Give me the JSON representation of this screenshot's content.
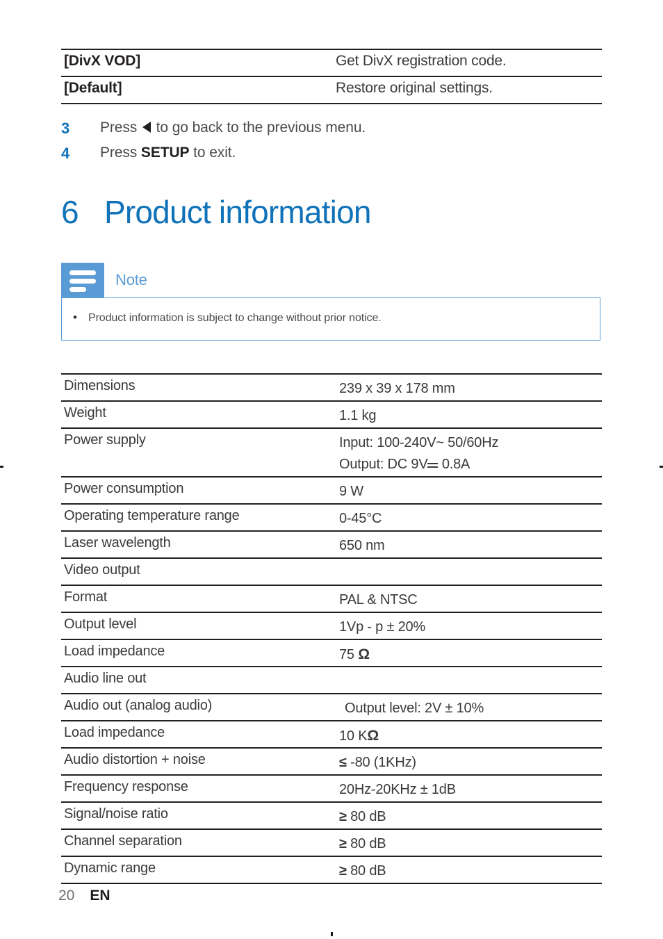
{
  "page": {
    "number": "20",
    "language": "EN"
  },
  "settings_table": {
    "rows": [
      {
        "label": "[DivX VOD]",
        "value": "Get DivX registration code."
      },
      {
        "label": "[Default]",
        "value": "Restore original settings."
      }
    ]
  },
  "steps": [
    {
      "num": "3",
      "text_before": "Press ",
      "icon": "left-arrow-icon",
      "text_after": " to go back to the previous menu."
    },
    {
      "num": "4",
      "text_before": "Press ",
      "bold": "SETUP",
      "text_after": " to exit."
    }
  ],
  "chapter": {
    "number": "6",
    "title": "Product information",
    "color": "#1072b8"
  },
  "note": {
    "icon": "note-lines-icon",
    "title": "Note",
    "accent_color": "#5b9bd5",
    "items": [
      "Product information is subject to change without prior notice."
    ]
  },
  "spec_table": {
    "rows": [
      {
        "label": "Dimensions",
        "value": "239 x 39 x 178 mm"
      },
      {
        "label": "Weight",
        "value": "1.1 kg"
      },
      {
        "label": "Power supply",
        "value_line1": "Input: 100-240V~ 50/60Hz",
        "value_line2_prefix": "Output: DC 9V",
        "value_line2_suffix": " 0.8A"
      },
      {
        "label": "Power consumption",
        "value": "9 W"
      },
      {
        "label": "Operating temperature range",
        "value": "0-45°C"
      },
      {
        "label": "Laser wavelength",
        "value": "650 nm"
      },
      {
        "label": "Video output",
        "value": ""
      },
      {
        "label": "Format",
        "value": "PAL & NTSC"
      },
      {
        "label": "Output level",
        "value": "1Vp - p ± 20%"
      },
      {
        "label": "Load impedance",
        "value_num": "75 ",
        "value_sym": "Ω"
      },
      {
        "label": "Audio line out",
        "value": ""
      },
      {
        "label": "Audio out (analog audio)",
        "value": "Output level: 2V ± 10%"
      },
      {
        "label": "Load impedance",
        "value_num": "10 K",
        "value_sym": "Ω"
      },
      {
        "label": "Audio distortion + noise",
        "value_sym": "≤",
        "value_num": " -80 (1KHz)"
      },
      {
        "label": "Frequency response",
        "value": "20Hz-20KHz ± 1dB"
      },
      {
        "label": "Signal/noise ratio",
        "value_sym": "≥",
        "value_num": " 80 dB"
      },
      {
        "label": "Channel separation",
        "value_sym": "≥",
        "value_num": " 80 dB"
      },
      {
        "label": "Dynamic range",
        "value_sym": "≥",
        "value_num": " 80 dB"
      }
    ]
  }
}
